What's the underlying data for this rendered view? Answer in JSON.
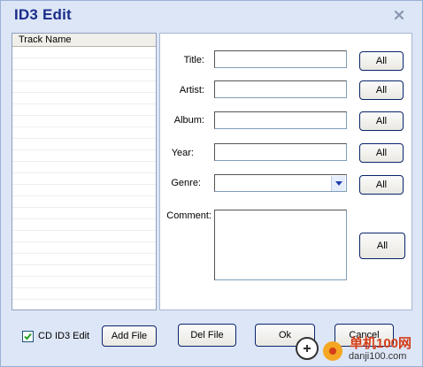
{
  "window": {
    "title": "ID3 Edit"
  },
  "track_list": {
    "header": "Track Name",
    "rows": []
  },
  "form": {
    "title_label": "Title:",
    "artist_label": "Artist:",
    "album_label": "Album:",
    "year_label": "Year:",
    "genre_label": "Genre:",
    "comment_label": "Comment:",
    "title_value": "",
    "artist_value": "",
    "album_value": "",
    "year_value": "",
    "genre_value": "",
    "comment_value": "",
    "all_label": "All"
  },
  "footer": {
    "cd_id3_edit_label": "CD ID3 Edit",
    "cd_id3_edit_checked": true,
    "add_file_label": "Add File",
    "del_file_label": "Del File",
    "ok_label": "Ok",
    "cancel_label": "Cancel"
  },
  "watermark": {
    "line1": "单机100网",
    "line2": "danji100.com"
  },
  "colors": {
    "title": "#1b2d8c",
    "window_bg": "#dde6f6",
    "button_border": "#0a246a"
  }
}
